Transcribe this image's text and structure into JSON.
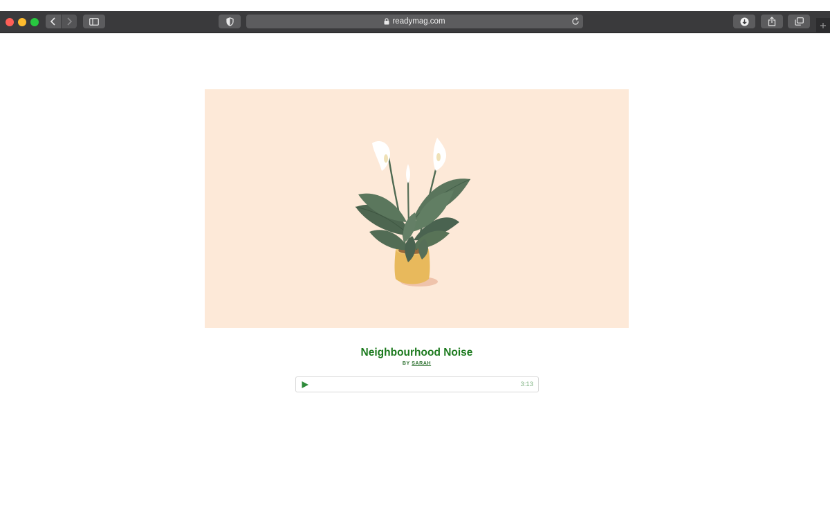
{
  "browser": {
    "url": "readymag.com",
    "buttons": {
      "back": "chevron-left-icon",
      "forward": "chevron-right-icon",
      "sidebar": "sidebar-icon",
      "privacy": "shield-icon",
      "reload": "reload-icon",
      "download": "download-icon",
      "share": "share-icon",
      "tabs": "tabs-icon",
      "new_tab": "plus-icon"
    }
  },
  "article": {
    "hero_image": "peace-lily-potted-plant-illustration",
    "hero_background": "#fde9d8",
    "title": "Neighbourhood Noise",
    "byline_prefix": "BY",
    "author": "SARAH",
    "accent_color": "#1c7a1e"
  },
  "audio_player": {
    "play_icon": "play-icon",
    "duration": "3:13"
  }
}
